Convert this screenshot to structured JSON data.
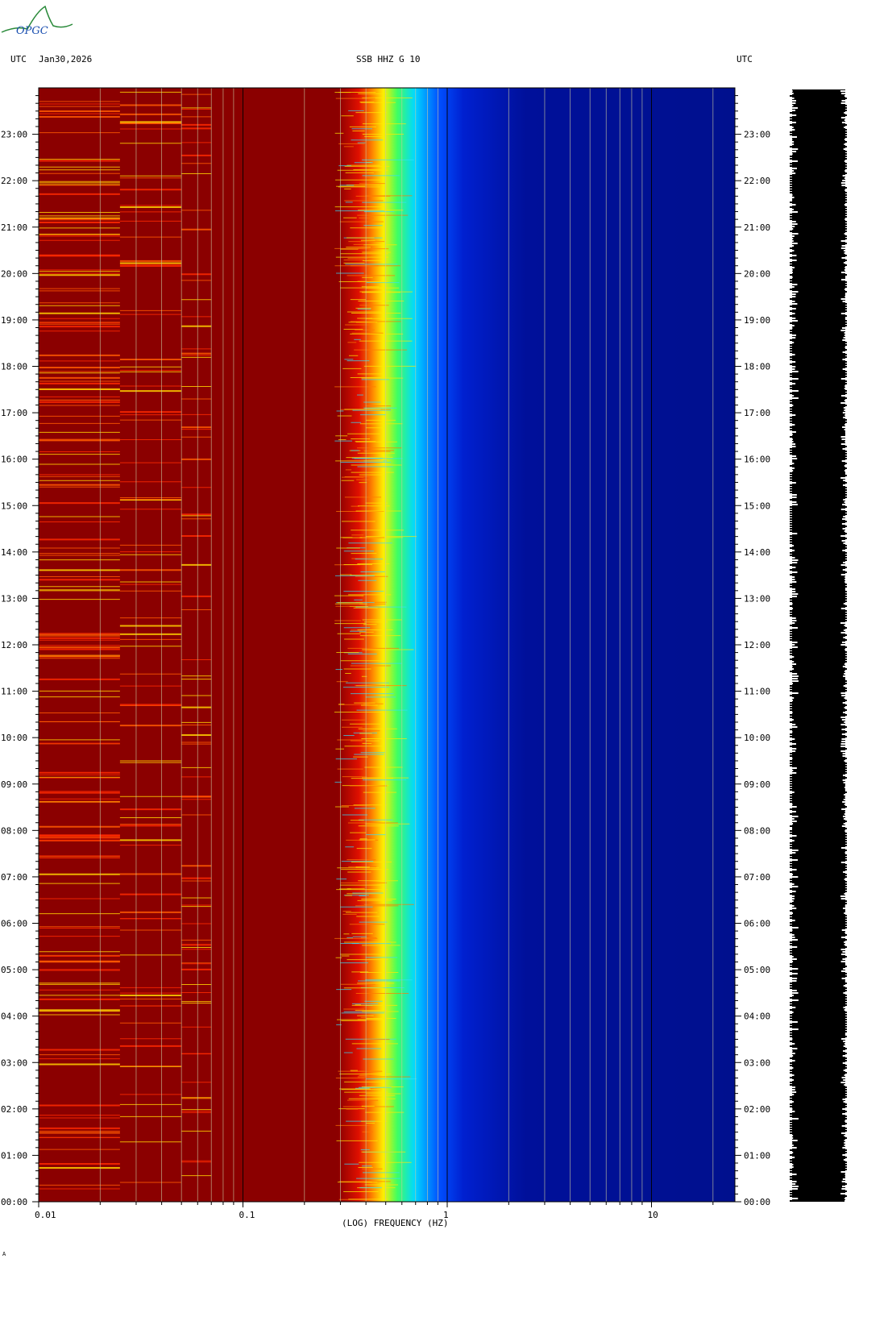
{
  "header": {
    "left_tz": "UTC",
    "date": "Jan30,2026",
    "station": "SSB HHZ G 10",
    "right_tz": "UTC"
  },
  "logo": {
    "text": "OPGC",
    "color": "#2a8a3a"
  },
  "chart_data": {
    "type": "heatmap",
    "title": "SSB HHZ G 10",
    "xlabel": "(LOG) FREQUENCY (HZ)",
    "ylabel": "",
    "x_scale": "log",
    "xlim": [
      0.01,
      25
    ],
    "x_ticks": [
      0.01,
      0.1,
      1,
      10
    ],
    "x_tick_labels": [
      "0.01",
      "0.1",
      "1",
      "10"
    ],
    "ylim_hours": [
      0,
      24
    ],
    "y_tick_labels": [
      "00:00",
      "01:00",
      "02:00",
      "03:00",
      "04:00",
      "05:00",
      "06:00",
      "07:00",
      "08:00",
      "09:00",
      "10:00",
      "11:00",
      "12:00",
      "13:00",
      "14:00",
      "15:00",
      "16:00",
      "17:00",
      "18:00",
      "19:00",
      "20:00",
      "21:00",
      "22:00",
      "23:00"
    ],
    "colormap": [
      "#00008b",
      "#0050ff",
      "#00d0ff",
      "#ffff00",
      "#ff8000",
      "#ff0000",
      "#8b0000"
    ],
    "description_bands": [
      {
        "from_hz": 0.01,
        "to_hz": 0.3,
        "level": "high"
      },
      {
        "from_hz": 0.3,
        "to_hz": 1.0,
        "level": "transition"
      },
      {
        "from_hz": 1.0,
        "to_hz": 25,
        "level": "low"
      }
    ],
    "grid": true
  },
  "footer": {
    "mark": "A"
  }
}
